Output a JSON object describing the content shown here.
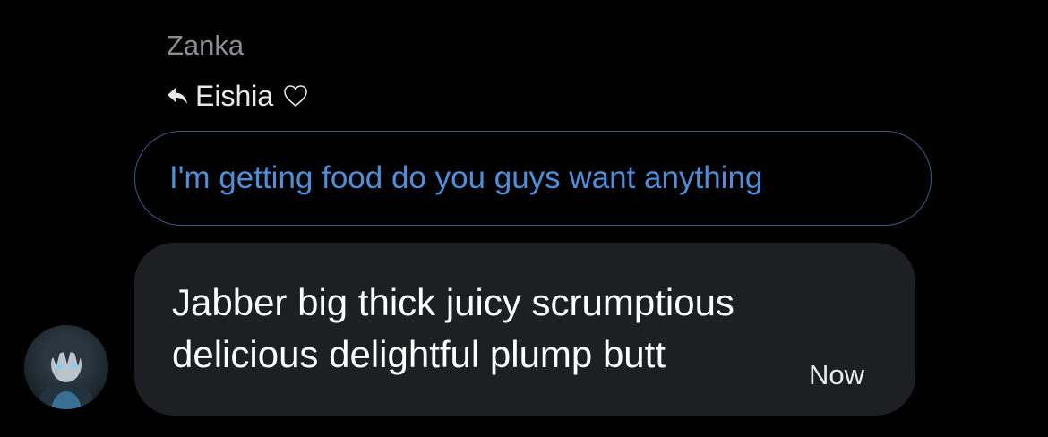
{
  "thread": {
    "sender_name": "Zanka",
    "reply_to": {
      "icon": "reply-arrow-icon",
      "name": "Eishia",
      "badge_icon": "heart-outline-icon"
    },
    "quoted_message": "I'm getting food do you guys want anything",
    "message": {
      "lines": [
        "Jabber big thick juicy scrumptious",
        "delicious delightful plump butt"
      ],
      "timestamp": "Now"
    },
    "avatar": "user-avatar"
  },
  "colors": {
    "background": "#000000",
    "sender_name": "#8b8f94",
    "quoted_text": "#4f8fda",
    "quoted_border": "#3b5a86",
    "bubble": "#1d1f23",
    "text": "#ffffff"
  }
}
